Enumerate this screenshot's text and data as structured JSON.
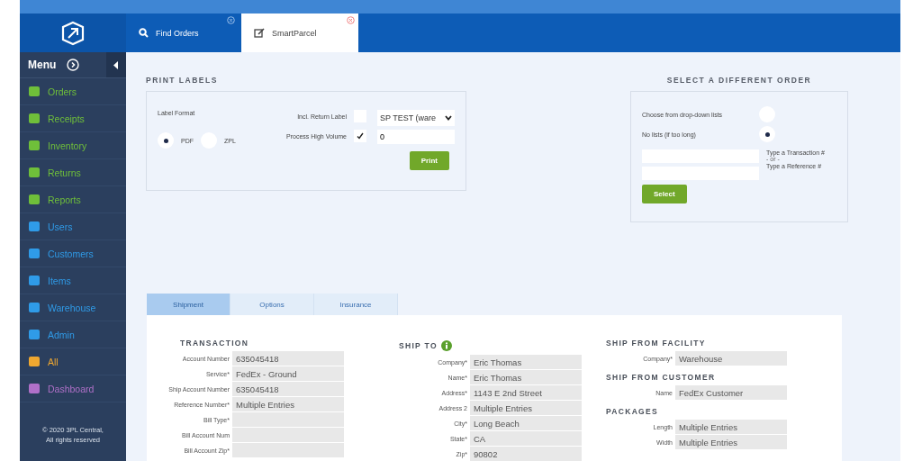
{
  "header": {
    "tabs": [
      {
        "label": "Find Orders",
        "selected": false
      },
      {
        "label": "SmartParcel",
        "selected": true
      }
    ]
  },
  "sidebar": {
    "title": "Menu",
    "items": [
      {
        "label": "Orders",
        "color": "#6fbf3a"
      },
      {
        "label": "Receipts",
        "color": "#6fbf3a"
      },
      {
        "label": "Inventory",
        "color": "#6fbf3a"
      },
      {
        "label": "Returns",
        "color": "#6fbf3a"
      },
      {
        "label": "Reports",
        "color": "#6fbf3a"
      },
      {
        "label": "Users",
        "color": "#2f9be8"
      },
      {
        "label": "Customers",
        "color": "#2f9be8"
      },
      {
        "label": "Items",
        "color": "#2f9be8"
      },
      {
        "label": "Warehouse",
        "color": "#2f9be8"
      },
      {
        "label": "Admin",
        "color": "#2f9be8"
      },
      {
        "label": "All",
        "color": "#f0a830"
      },
      {
        "label": "Dashboard",
        "color": "#b070c8"
      }
    ],
    "footer": [
      "© 2020 3PL Central,",
      "All rights reserved"
    ]
  },
  "print_labels": {
    "title": "PRINT LABELS",
    "format_label": "Label Format",
    "formats": [
      {
        "label": "PDF",
        "selected": true
      },
      {
        "label": "ZPL",
        "selected": false
      }
    ],
    "options": [
      {
        "label": "Incl. Return Label",
        "checked": false
      },
      {
        "label": "Process High Volume",
        "checked": true
      }
    ],
    "printer": "SP TEST (ware",
    "quantity": "0",
    "button": "Print"
  },
  "select_order": {
    "title": "SELECT A DIFFERENT ORDER",
    "modes": [
      {
        "label": "Choose from drop-down lists",
        "selected": false
      },
      {
        "label": "No lists (if too long)",
        "selected": true
      }
    ],
    "transaction_hint": "Type a Transaction #",
    "or": "- or -",
    "reference_hint": "Type a Reference #",
    "button": "Select"
  },
  "detail_tabs": [
    {
      "label": "Shipment",
      "selected": true
    },
    {
      "label": "Options",
      "selected": false
    },
    {
      "label": "Insurance",
      "selected": false
    }
  ],
  "transaction": {
    "title": "TRANSACTION",
    "fields": [
      {
        "label": "Account Number",
        "value": "635045418"
      },
      {
        "label": "Service*",
        "value": "FedEx - Ground"
      },
      {
        "label": "Ship Account Number",
        "value": "635045418"
      },
      {
        "label": "Reference Number*",
        "value": "Multiple Entries"
      },
      {
        "label": "Bill Type*"
      },
      {
        "label": "Bill Account Num"
      },
      {
        "label": "Bill Account Zip*"
      }
    ]
  },
  "ship_to": {
    "title": "SHIP TO",
    "fields": [
      {
        "label": "Company*",
        "value": "Eric Thomas"
      },
      {
        "label": "Name*",
        "value": "Eric Thomas"
      },
      {
        "label": "Address*",
        "value": "1143 E 2nd Street"
      },
      {
        "label": "Address 2",
        "value": "Multiple Entries"
      },
      {
        "label": "City*",
        "value": "Long Beach"
      },
      {
        "label": "State*",
        "value": "CA"
      },
      {
        "label": "Zip*",
        "value": "90802"
      }
    ]
  },
  "ship_from_facility": {
    "title": "SHIP FROM FACILITY",
    "fields": [
      {
        "label": "Company*",
        "value": "Warehouse"
      }
    ]
  },
  "ship_from_customer": {
    "title": "SHIP FROM CUSTOMER",
    "fields": [
      {
        "label": "Name",
        "value": "FedEx Customer"
      }
    ]
  },
  "packages": {
    "title": "PACKAGES",
    "fields": [
      {
        "label": "Length",
        "value": "Multiple Entries"
      },
      {
        "label": "Width",
        "value": "Multiple Entries"
      }
    ]
  }
}
